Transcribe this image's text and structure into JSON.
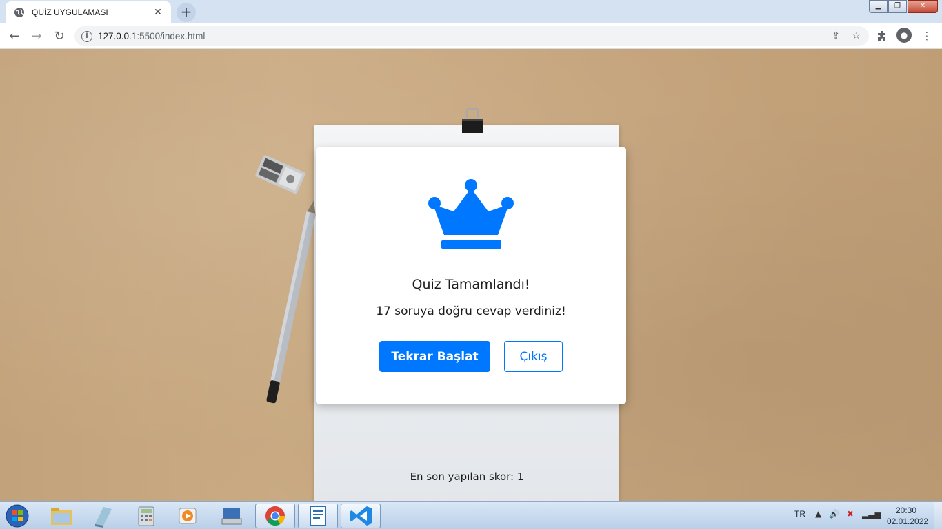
{
  "browser": {
    "tab_title": "QUİZ UYGULAMASI",
    "tab_close": "✕",
    "new_tab": "+",
    "url_host": "127.0.0.1",
    "url_rest": ":5500/index.html"
  },
  "card": {
    "title": "Quiz Tamamlandı!",
    "message": "17 soruya doğru cevap verdiniz!",
    "restart_label": "Tekrar Başlat",
    "exit_label": "Çıkış"
  },
  "footer": {
    "score_text": "En son yapılan skor: 1"
  },
  "taskbar": {
    "language": "TR",
    "time": "20:30",
    "date": "02.01.2022"
  },
  "colors": {
    "accent": "#0077ff"
  }
}
